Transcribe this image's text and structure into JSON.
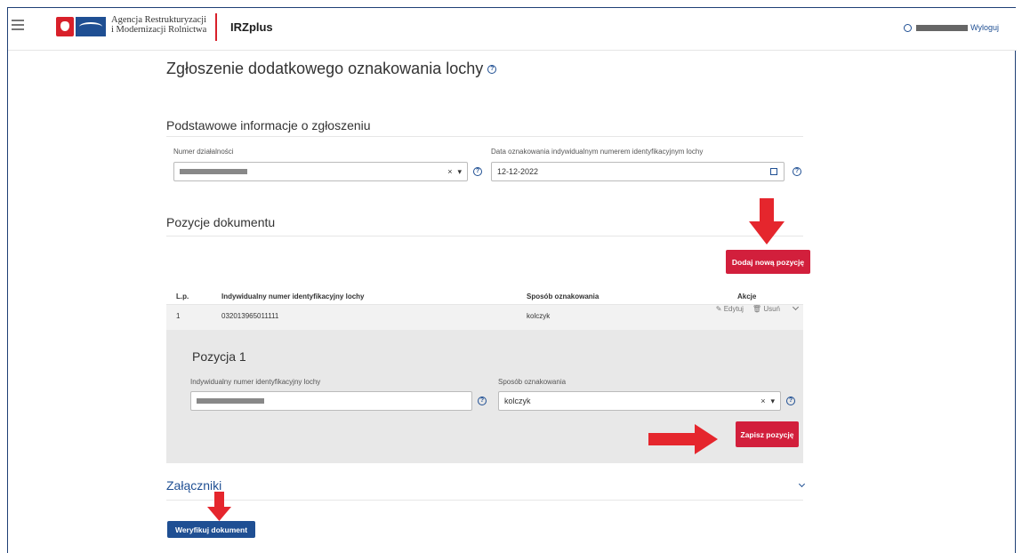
{
  "header": {
    "agency_line1": "Agencja Restrukturyzacji",
    "agency_line2": "i Modernizacji Rolnictwa",
    "app_name": "IRZplus",
    "logout": "Wyloguj"
  },
  "page": {
    "title": "Zgłoszenie dodatkowego oznakowania lochy"
  },
  "basic_info": {
    "title": "Podstawowe informacje o zgłoszeniu",
    "activity_number_label": "Numer działalności",
    "date_label": "Data oznakowania indywidualnym numerem identyfikacyjnym lochy",
    "date_value": "12-12-2022"
  },
  "positions": {
    "title": "Pozycje dokumentu",
    "add_button": "Dodaj nową pozycję",
    "columns": {
      "lp": "L.p.",
      "id_number": "Indywidualny numer identyfikacyjny lochy",
      "method": "Sposób oznakowania",
      "actions": "Akcje"
    },
    "rows": [
      {
        "lp": "1",
        "id_number": "032013965011111",
        "method": "kolczyk",
        "edit": "Edytuj",
        "delete": "Usuń"
      }
    ],
    "detail": {
      "title": "Pozycja 1",
      "id_label": "Indywidualny numer identyfikacyjny lochy",
      "method_label": "Sposób oznakowania",
      "method_value": "kolczyk",
      "save_button": "Zapisz pozycję"
    }
  },
  "attachments": {
    "title": "Załączniki"
  },
  "footer": {
    "verify_button": "Weryfikuj dokument"
  },
  "colors": {
    "primary": "#1f4f93",
    "danger": "#d21f3c",
    "arrow": "#e5262d"
  }
}
